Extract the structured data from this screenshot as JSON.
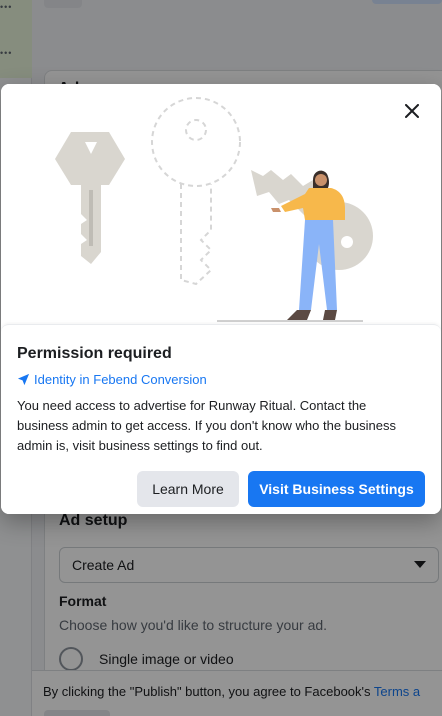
{
  "background": {
    "card_title": "Ad",
    "ad_setup_title": "Ad setup",
    "select_value": "Create Ad",
    "format_label": "Format",
    "format_help": "Choose how you'd like to structure your ad.",
    "radio_option": "Single image or video",
    "footer_text": "By clicking the \"Publish\" button, you agree to Facebook's ",
    "footer_link": "Terms a"
  },
  "modal": {
    "title": "Permission required",
    "identity": "Identity in Febend Conversion",
    "description": "You need access to advertise for Runway Ritual. Contact the business admin to get access. If you don't know who the business admin is, visit business settings to find out.",
    "learn_more_label": "Learn More",
    "visit_settings_label": "Visit Business Settings"
  },
  "colors": {
    "accent": "#1877f2",
    "secondary_button": "#e4e6eb",
    "person_shirt": "#f7b84b",
    "person_pants": "#8ab4f8",
    "key": "#d9d6cf"
  },
  "icons": {
    "close": "close-icon",
    "identity": "location-arrow-icon",
    "dropdown": "caret-down-icon"
  }
}
